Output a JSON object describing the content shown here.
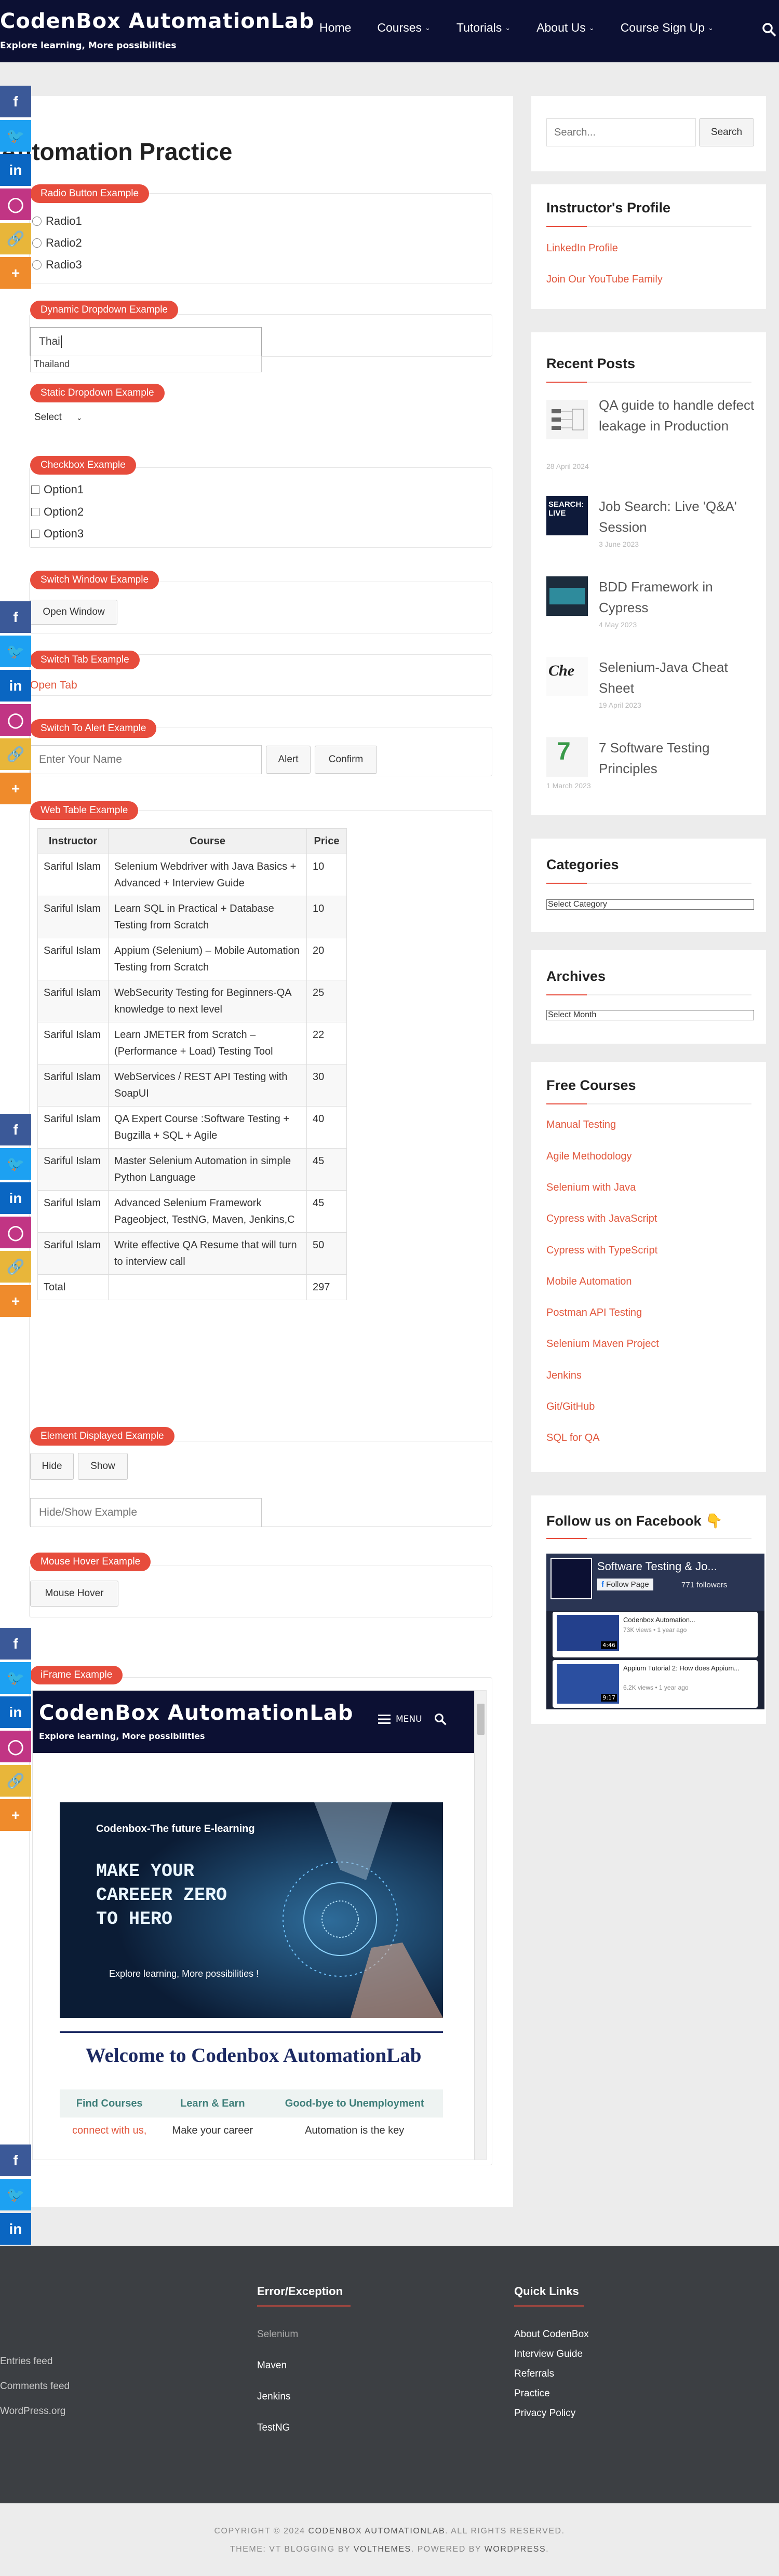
{
  "header": {
    "title": "CodenBox AutomationLab",
    "tagline": "Explore learning, More possibilities",
    "nav": [
      "Home",
      "Courses",
      "Tutorials",
      "About Us",
      "Course Sign Up"
    ],
    "search_icon": "search-icon"
  },
  "main": {
    "page_title": "Automation Practice",
    "radio": {
      "label": "Radio Button Example",
      "options": [
        "Radio1",
        "Radio2",
        "Radio3"
      ]
    },
    "dynamic": {
      "label": "Dynamic Dropdown Example",
      "value": "Thai",
      "suggestion": "Thailand"
    },
    "static": {
      "label": "Static Dropdown Example",
      "selected": "Select"
    },
    "checkbox": {
      "label": "Checkbox Example",
      "options": [
        "Option1",
        "Option2",
        "Option3"
      ]
    },
    "switch_window": {
      "label": "Switch Window Example",
      "button": "Open Window"
    },
    "switch_tab": {
      "label": "Switch Tab Example",
      "link": "Open Tab"
    },
    "alert": {
      "label": "Switch To Alert Example",
      "placeholder": "Enter Your Name",
      "alert_btn": "Alert",
      "confirm_btn": "Confirm"
    },
    "web_table": {
      "label": "Web Table Example",
      "headers": [
        "Instructor",
        "Course",
        "Price"
      ],
      "rows": [
        [
          "Sariful Islam",
          "Selenium Webdriver with Java Basics + Advanced + Interview Guide",
          "10"
        ],
        [
          "Sariful Islam",
          "Learn SQL in Practical + Database Testing from Scratch",
          "10"
        ],
        [
          "Sariful Islam",
          "Appium (Selenium) – Mobile Automation Testing from Scratch",
          "20"
        ],
        [
          "Sariful Islam",
          "WebSecurity Testing for Beginners-QA knowledge to next level",
          "25"
        ],
        [
          "Sariful Islam",
          "Learn JMETER from Scratch –(Performance + Load) Testing Tool",
          "22"
        ],
        [
          "Sariful Islam",
          "WebServices / REST API Testing with SoapUI",
          "30"
        ],
        [
          "Sariful Islam",
          "QA Expert Course :Software Testing + Bugzilla + SQL + Agile",
          "40"
        ],
        [
          "Sariful Islam",
          "Master Selenium Automation in simple Python Language",
          "45"
        ],
        [
          "Sariful Islam",
          "Advanced Selenium Framework Pageobject, TestNG, Maven, Jenkins,C",
          "45"
        ],
        [
          "Sariful Islam",
          "Write effective QA Resume that will turn to interview call",
          "50"
        ]
      ],
      "total_label": "Total",
      "total_value": "297"
    },
    "element_displayed": {
      "label": "Element Displayed Example",
      "hide_btn": "Hide",
      "show_btn": "Show",
      "placeholder": "Hide/Show Example"
    },
    "mouse_hover": {
      "label": "Mouse Hover Example",
      "button": "Mouse Hover"
    },
    "iframe": {
      "label": "iFrame Example",
      "title": "CodenBox AutomationLab",
      "tagline": "Explore learning, More possibilities",
      "menu": "MENU",
      "banner_top": "Codenbox-The future E-learning",
      "banner_headline": [
        "MAKE YOUR",
        "CAREEER ZERO",
        "TO HERO"
      ],
      "banner_bottom": "Explore learning, More possibilities !",
      "welcome": "Welcome to Codenbox AutomationLab",
      "table_headers": [
        "Find Courses",
        "Learn & Earn",
        "Good-bye to Unemployment"
      ],
      "table_row": [
        "connect with us,",
        "Make your career",
        "Automation is the key"
      ]
    }
  },
  "sidebar": {
    "search_placeholder": "Search...",
    "search_btn": "Search",
    "profile": {
      "title": "Instructor's Profile",
      "links": [
        "LinkedIn Profile",
        "Join Our YouTube Family"
      ]
    },
    "recent": {
      "title": "Recent Posts",
      "posts": [
        {
          "title": "QA guide to handle defect leakage in Production",
          "date": "28 April 2024"
        },
        {
          "title": "Job Search: Live 'Q&A' Session",
          "date": "3 June 2023"
        },
        {
          "title": "BDD Framework in Cypress",
          "date": "4 May 2023"
        },
        {
          "title": "Selenium-Java Cheat Sheet",
          "date": "19 April 2023"
        },
        {
          "title": "7 Software Testing Principles",
          "date": "1 March 2023"
        }
      ]
    },
    "categories": {
      "title": "Categories",
      "select": "Select Category"
    },
    "archives": {
      "title": "Archives",
      "select": "Select Month"
    },
    "free_courses": {
      "title": "Free Courses",
      "links": [
        "Manual Testing",
        "Agile Methodology",
        "Selenium with Java",
        "Cypress with JavaScript",
        "Cypress with TypeScript",
        "Mobile Automation",
        "Postman API Testing",
        "Selenium Maven Project",
        "Jenkins",
        "Git/GitHub",
        "SQL for QA"
      ]
    },
    "facebook": {
      "title": "Follow us on Facebook",
      "emoji": "👇",
      "page_name": "Software Testing & Jo...",
      "follow": "Follow Page",
      "followers": "771 followers",
      "videos": [
        {
          "title": "Codenbox Automation...",
          "meta": "73K views • 1 year ago",
          "dur": "4:46"
        },
        {
          "title": "Appium Tutorial 2: How does Appium...",
          "meta": "6.2K views • 1 year ago",
          "dur": "9:17"
        }
      ]
    }
  },
  "social": {
    "buttons": [
      "f",
      "t",
      "in",
      "ig",
      "link",
      "+"
    ]
  },
  "footer": {
    "col1": [
      "Entries feed",
      "Comments feed",
      "WordPress.org"
    ],
    "col2_title": "Error/Exception",
    "col2": [
      "Selenium",
      "Maven",
      "Jenkins",
      "TestNG"
    ],
    "col3_title": "Quick Links",
    "col3": [
      "About CodenBox",
      "Interview Guide",
      "Referrals",
      "Practice",
      "Privacy Policy"
    ],
    "copyright": "COPYRIGHT © 2024",
    "brand": "CODENBOX AUTOMATIONLAB",
    "rights": ". ALL RIGHTS RESERVED.",
    "theme_pre": "THEME:",
    "theme_name": "VT BLOGGING",
    "theme_by": "BY",
    "theme_author": "VOLTHEMES",
    "powered": ". POWERED BY",
    "wp": "WORDPRESS",
    "end": "."
  }
}
